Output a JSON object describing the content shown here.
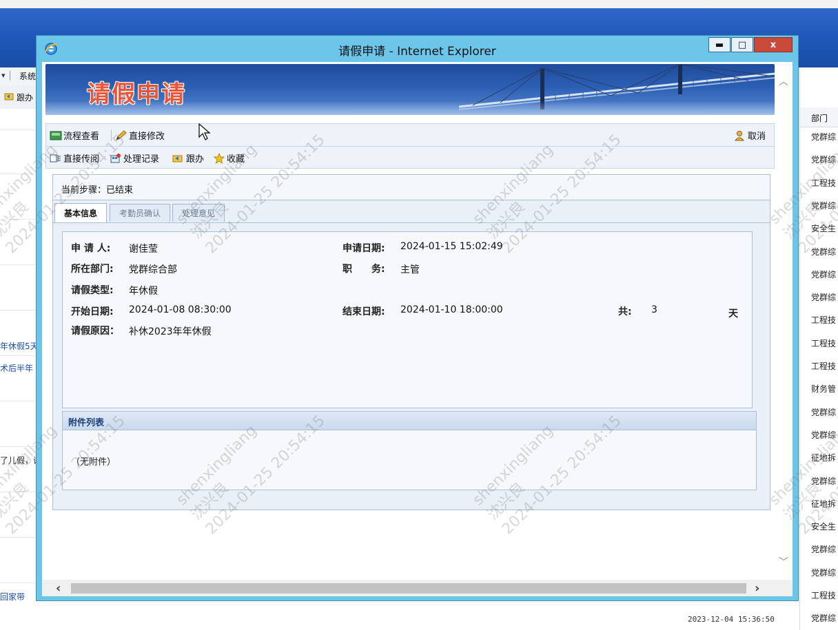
{
  "background": {
    "menubar_text": "系统",
    "toolbar_text": "跟办",
    "left_snippets": [
      "年休假5天",
      "术后半年",
      "了儿假，请",
      "回家带"
    ],
    "right_column_header": "部门",
    "right_column_cells": [
      "党群综",
      "党群综",
      "工程技",
      "党群综",
      "安全生",
      "党群综",
      "党群综",
      "党群综",
      "工程技",
      "工程技",
      "工程技",
      "财务管",
      "党群综",
      "党群综",
      "征地拆",
      "党群综",
      "征地拆",
      "安全生",
      "党群综",
      "党群综",
      "工程技",
      "党群综"
    ],
    "timestamp": "2023-12-04 15:36:50"
  },
  "window": {
    "title": "请假申请 - Internet Explorer",
    "min_label": "▬",
    "max_label": "□",
    "close_label": "x"
  },
  "banner": {
    "title": "请假申请"
  },
  "toolbar1": {
    "flow_view": "流程查看",
    "direct_edit": "直接修改",
    "cancel": "取消"
  },
  "toolbar2": {
    "direct_forward": "直接传阅",
    "process_record": "处理记录",
    "follow": "跟办",
    "favorite": "收藏"
  },
  "step": {
    "label": "当前步骤：",
    "value": "已结束"
  },
  "tabs": [
    {
      "label": "基本信息",
      "active": true
    },
    {
      "label": "考勤员确认",
      "active": false
    },
    {
      "label": "处理意见",
      "active": false
    }
  ],
  "form": {
    "applicant_label": "申 请 人:",
    "applicant": "谢佳莹",
    "apply_date_label": "申请日期:",
    "apply_date": "2024-01-15 15:02:49",
    "dept_label": "所在部门:",
    "dept": "党群综合部",
    "position_label": "职　　务:",
    "position": "主管",
    "type_label": "请假类型:",
    "type": "年休假",
    "start_label": "开始日期:",
    "start": "2024-01-08 08:30:00",
    "end_label": "结束日期:",
    "end": "2024-01-10 18:00:00",
    "total_label": "共:",
    "total": "3",
    "unit": "天",
    "reason_label": "请假原因：",
    "reason": "补休2023年年休假"
  },
  "attachments": {
    "title": "附件列表",
    "empty": "（无附件）"
  },
  "watermark": {
    "user": "shenxingliang",
    "name": "沈兴良",
    "time": "2024-01-25 20:54:15"
  },
  "colors": {
    "banner_blue": "#1f4b9a",
    "window_frame": "#6cc6ea",
    "close_red": "#c9493a",
    "title_orange": "#e8563a"
  }
}
